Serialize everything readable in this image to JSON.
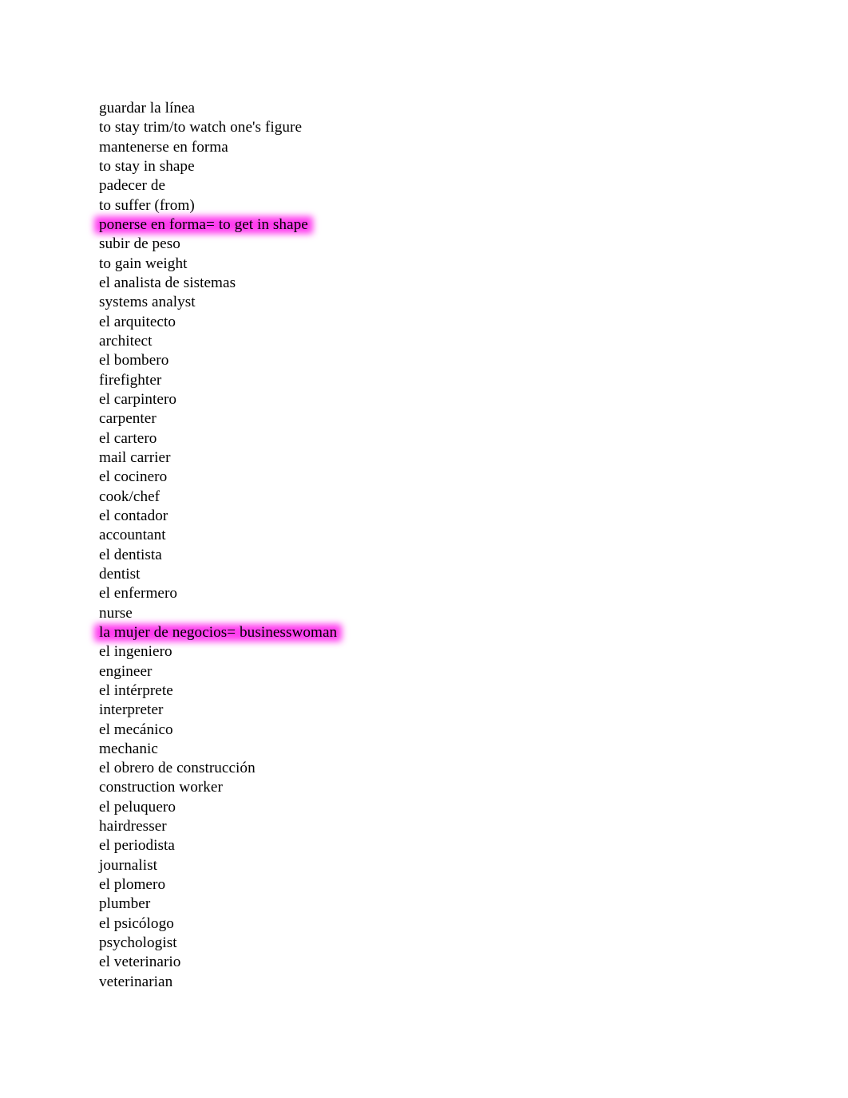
{
  "document": {
    "page_background": "#ffffff",
    "text_color": "#000000",
    "highlight_color": "#ff3def",
    "lines": [
      {
        "text": "guardar la línea",
        "highlighted": false
      },
      {
        "text": "to stay trim/to watch one's figure",
        "highlighted": false
      },
      {
        "text": "mantenerse en forma",
        "highlighted": false
      },
      {
        "text": "to stay in shape",
        "highlighted": false
      },
      {
        "text": "padecer de",
        "highlighted": false
      },
      {
        "text": "to suffer (from)",
        "highlighted": false
      },
      {
        "text": "ponerse en forma= to get in shape",
        "highlighted": true
      },
      {
        "text": "subir de peso",
        "highlighted": false
      },
      {
        "text": "to gain weight",
        "highlighted": false
      },
      {
        "text": "el analista de sistemas",
        "highlighted": false
      },
      {
        "text": "systems analyst",
        "highlighted": false
      },
      {
        "text": "el arquitecto",
        "highlighted": false
      },
      {
        "text": "architect",
        "highlighted": false
      },
      {
        "text": "el bombero",
        "highlighted": false
      },
      {
        "text": "firefighter",
        "highlighted": false
      },
      {
        "text": "el carpintero",
        "highlighted": false
      },
      {
        "text": "carpenter",
        "highlighted": false
      },
      {
        "text": "el cartero",
        "highlighted": false
      },
      {
        "text": "mail carrier",
        "highlighted": false
      },
      {
        "text": "el cocinero",
        "highlighted": false
      },
      {
        "text": "cook/chef",
        "highlighted": false
      },
      {
        "text": "el contador",
        "highlighted": false
      },
      {
        "text": "accountant",
        "highlighted": false
      },
      {
        "text": "el dentista",
        "highlighted": false
      },
      {
        "text": "dentist",
        "highlighted": false
      },
      {
        "text": "el enfermero",
        "highlighted": false
      },
      {
        "text": "nurse",
        "highlighted": false
      },
      {
        "text": "la mujer de negocios= businesswoman",
        "highlighted": true
      },
      {
        "text": "el ingeniero",
        "highlighted": false
      },
      {
        "text": "engineer",
        "highlighted": false
      },
      {
        "text": "el intérprete",
        "highlighted": false
      },
      {
        "text": "interpreter",
        "highlighted": false
      },
      {
        "text": "el mecánico",
        "highlighted": false
      },
      {
        "text": "mechanic",
        "highlighted": false
      },
      {
        "text": "el obrero de construcción",
        "highlighted": false
      },
      {
        "text": "construction worker",
        "highlighted": false
      },
      {
        "text": "el peluquero",
        "highlighted": false
      },
      {
        "text": "hairdresser",
        "highlighted": false
      },
      {
        "text": "el periodista",
        "highlighted": false
      },
      {
        "text": "journalist",
        "highlighted": false
      },
      {
        "text": "el plomero",
        "highlighted": false
      },
      {
        "text": "plumber",
        "highlighted": false
      },
      {
        "text": "el psicólogo",
        "highlighted": false
      },
      {
        "text": "psychologist",
        "highlighted": false
      },
      {
        "text": "el veterinario",
        "highlighted": false
      },
      {
        "text": "veterinarian",
        "highlighted": false
      }
    ]
  }
}
